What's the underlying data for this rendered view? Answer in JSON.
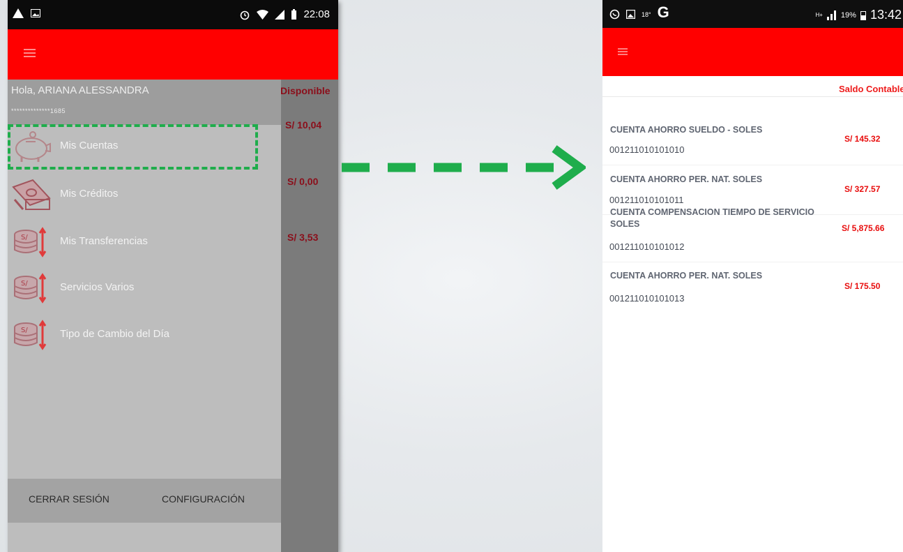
{
  "left_screen": {
    "status_bar": {
      "time": "22:08"
    },
    "drawer": {
      "greeting": "Hola, ARIANA ALESSANDRA",
      "account_masked": "**************1685",
      "menu": [
        {
          "label": "Mis Cuentas",
          "icon": "piggy-bank-icon"
        },
        {
          "label": "Mis Créditos",
          "icon": "money-stack-icon"
        },
        {
          "label": "Mis Transferencias",
          "icon": "coins-transfer-icon"
        },
        {
          "label": "Servicios Varios",
          "icon": "coins-transfer-icon"
        },
        {
          "label": "Tipo de Cambio del Día",
          "icon": "coins-transfer-icon"
        }
      ],
      "footer": {
        "logout_label": "CERRAR SESIÓN",
        "settings_label": "CONFIGURACIÓN"
      }
    },
    "background_list": {
      "header": "Disponible",
      "amounts": [
        "S/ 10,04",
        "S/ 0,00",
        "S/ 3,53"
      ]
    }
  },
  "right_screen": {
    "status_bar": {
      "whatsapp_label": "18°",
      "network": "H+",
      "battery": "19%",
      "time": "13:42",
      "g_label": "G"
    },
    "column_header": "Saldo Contable",
    "accounts": [
      {
        "name": "CUENTA AHORRO SUELDO - SOLES",
        "number": "001211010101010",
        "balance": "S/ 145.32"
      },
      {
        "name": "CUENTA AHORRO PER. NAT. SOLES",
        "number": "001211010101011",
        "balance": "S/ 327.57"
      },
      {
        "name": "CUENTA COMPENSACION TIEMPO DE SERVICIO SOLES",
        "number": "001211010101012",
        "balance": "S/ 5,875.66"
      },
      {
        "name": "CUENTA AHORRO PER. NAT. SOLES",
        "number": "001211010101013",
        "balance": "S/ 175.50"
      }
    ]
  },
  "colors": {
    "brand_red": "#ff0000",
    "highlight_green": "#1fad4c",
    "balance_red": "#e80c0c"
  }
}
